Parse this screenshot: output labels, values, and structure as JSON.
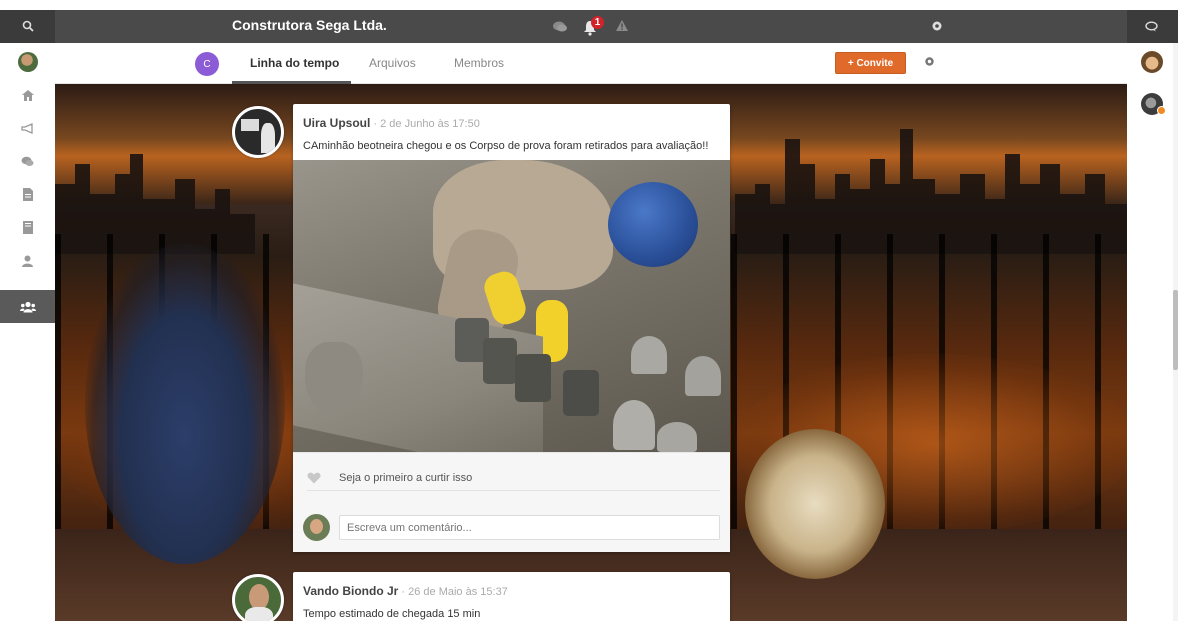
{
  "app": {
    "title": "Construtora Sega Ltda."
  },
  "topbar": {
    "notification_count": "1",
    "icons": [
      "search-icon",
      "chat-icon",
      "bell-icon",
      "alert-icon",
      "gear-icon",
      "chat-toggle-icon"
    ]
  },
  "sidebar": {
    "items": [
      {
        "name": "profile-avatar",
        "icon": "avatar"
      },
      {
        "name": "home",
        "icon": "home-icon"
      },
      {
        "name": "announcements",
        "icon": "megaphone-icon"
      },
      {
        "name": "chat",
        "icon": "chat-icon"
      },
      {
        "name": "documents",
        "icon": "document-icon"
      },
      {
        "name": "notes",
        "icon": "notebook-icon"
      },
      {
        "name": "profile",
        "icon": "user-icon"
      },
      {
        "name": "groups",
        "icon": "group-icon",
        "active": true
      }
    ]
  },
  "group": {
    "avatar_letter": "C",
    "avatar_color": "#8c5bd6",
    "tabs": [
      {
        "label": "Linha do tempo",
        "active": true
      },
      {
        "label": "Arquivos"
      },
      {
        "label": "Membros"
      }
    ],
    "invite_label": "+ Convite",
    "invite_color": "#e06a2a"
  },
  "posts": [
    {
      "author": "Uira Upsoul",
      "meta": " · 2 de Junho às 17:50",
      "text": "CAminhão beotneira chegou e os Corpso de prova foram retirados para avaliação!!",
      "likes_text": "Seja o primeiro a curtir isso",
      "comment_placeholder": "Escreva um comentário..."
    },
    {
      "author": "Vando Biondo Jr",
      "meta": " · 26 de Maio às 15:37",
      "text": "Tempo estimado de chegada 15 min"
    }
  ]
}
